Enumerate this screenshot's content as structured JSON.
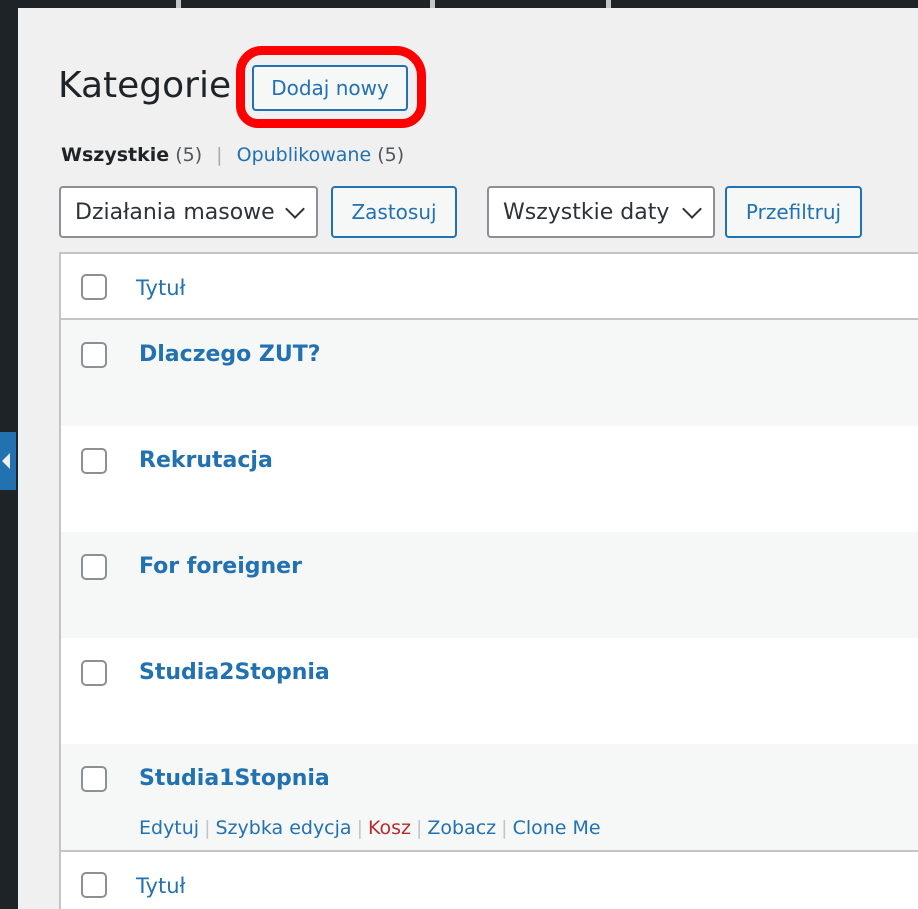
{
  "page": {
    "title": "Kategorie",
    "add_new_label": "Dodaj nowy"
  },
  "filters_nav": {
    "all_label": "Wszystkie",
    "all_count": "(5)",
    "published_label": "Opublikowane",
    "published_count": "(5)",
    "separator": "|"
  },
  "toolbar": {
    "bulk_actions_value": "Działania masowe",
    "apply_label": "Zastosuj",
    "dates_value": "Wszystkie daty",
    "filter_label": "Przefiltruj"
  },
  "table": {
    "column_title": "Tytuł",
    "footer_column_title": "Tytuł",
    "rows": [
      {
        "title": "Dlaczego ZUT?"
      },
      {
        "title": "Rekrutacja"
      },
      {
        "title": "For foreigner"
      },
      {
        "title": "Studia2Stopnia"
      },
      {
        "title": "Studia1Stopnia"
      }
    ],
    "row_actions": {
      "edit": "Edytuj",
      "quick_edit": "Szybka edycja",
      "trash": "Kosz",
      "view": "Zobacz",
      "clone": "Clone Me",
      "separator": "|"
    }
  },
  "colors": {
    "accent": "#2271b1",
    "highlight": "#ff0000",
    "trash": "#b32d2e"
  }
}
